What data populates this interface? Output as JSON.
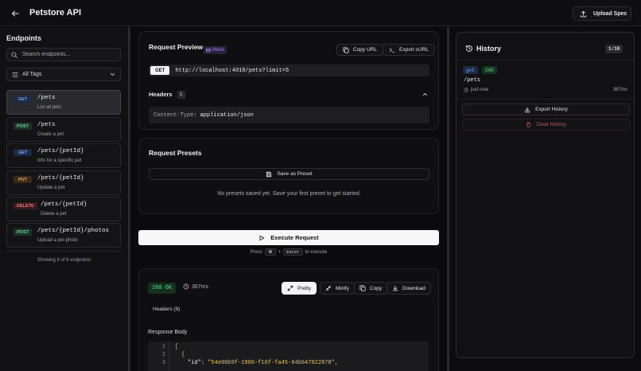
{
  "header": {
    "title": "Petstore API",
    "upload_label": "Upload Spec"
  },
  "sidebar": {
    "title": "Endpoints",
    "search_placeholder": "Search endpoints...",
    "tags_label": "All Tags",
    "endpoints": [
      {
        "method": "GET",
        "path": "/pets",
        "desc": "List all pets"
      },
      {
        "method": "POST",
        "path": "/pets",
        "desc": "Create a pet"
      },
      {
        "method": "GET",
        "path": "/pets/{petId}",
        "desc": "Info for a specific pet"
      },
      {
        "method": "PUT",
        "path": "/pets/{petId}",
        "desc": "Update a pet"
      },
      {
        "method": "DELETE",
        "path": "/pets/{petId}",
        "desc": "Delete a pet"
      },
      {
        "method": "POST",
        "path": "/pets/{petId}/photos",
        "desc": "Upload a pet photo"
      }
    ],
    "count_text": "Showing 6 of 6 endpoints"
  },
  "preview": {
    "title": "Request Preview",
    "mock_label": "Mock",
    "copy_url": "Copy URL",
    "export_curl": "Export cURL",
    "method": "GET",
    "url": "http://localhost:4010/pets?limit=5",
    "headers_label": "Headers",
    "headers_count": "1",
    "header_key": "Content-Type:",
    "header_value": "application/json"
  },
  "presets": {
    "title": "Request Presets",
    "save_label": "Save as Preset",
    "empty_text": "No presets saved yet. Save your first preset to get started."
  },
  "execute": {
    "label": "Execute Request",
    "hint_press": "Press",
    "hint_key1": "⌘",
    "hint_plus": "+",
    "hint_key2": "Enter",
    "hint_suffix": "to execute"
  },
  "response": {
    "status": "200 OK",
    "time": "367ms",
    "pretty": "Pretty",
    "minify": "Minify",
    "copy": "Copy",
    "download": "Download",
    "headers_tab": "Headers (9)",
    "body_label": "Response Body",
    "lines": [
      {
        "n": "1",
        "text": "["
      },
      {
        "n": "2",
        "text": "{"
      },
      {
        "n": "3",
        "key": "\"id\"",
        "value": "\"54e00b9f-1906-f16f-fa45-64b647022878\","
      }
    ]
  },
  "history": {
    "title": "History",
    "count": "1/10",
    "item": {
      "method": "get",
      "status": "200",
      "path": "/pets",
      "when": "just now",
      "duration": "367ms"
    },
    "export_label": "Export History",
    "clear_label": "Clear History"
  },
  "colors": {
    "accent": "#f7f7f8",
    "success": "#5fd691",
    "danger": "#c55a60",
    "mock": "#a98ae8"
  }
}
